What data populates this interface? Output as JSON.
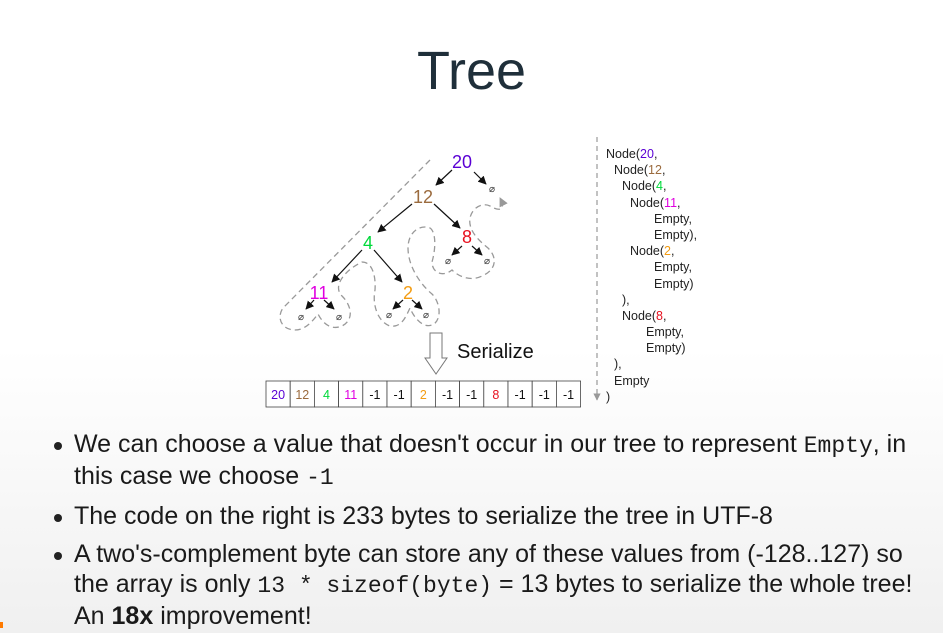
{
  "title": "Tree",
  "colors": {
    "purple": "#5a00d4",
    "brown": "#9b6b3e",
    "green": "#00d93a",
    "magenta": "#e000e0",
    "orange": "#f39c12",
    "red": "#e8101e",
    "gray_path": "#999999"
  },
  "tree": {
    "nodes": [
      {
        "label": "20",
        "color": "purple"
      },
      {
        "label": "12",
        "color": "brown"
      },
      {
        "label": "4",
        "color": "green"
      },
      {
        "label": "8",
        "color": "red"
      },
      {
        "label": "11",
        "color": "magenta"
      },
      {
        "label": "2",
        "color": "orange"
      }
    ],
    "empty_symbol": "⌀"
  },
  "serialize_label": "Serialize",
  "array": [
    {
      "value": "20",
      "color": "purple"
    },
    {
      "value": "12",
      "color": "brown"
    },
    {
      "value": "4",
      "color": "green"
    },
    {
      "value": "11",
      "color": "magenta"
    },
    {
      "value": "-1",
      "color": "black"
    },
    {
      "value": "-1",
      "color": "black"
    },
    {
      "value": "2",
      "color": "orange"
    },
    {
      "value": "-1",
      "color": "black"
    },
    {
      "value": "-1",
      "color": "black"
    },
    {
      "value": "8",
      "color": "red"
    },
    {
      "value": "-1",
      "color": "black"
    },
    {
      "value": "-1",
      "color": "black"
    },
    {
      "value": "-1",
      "color": "black"
    }
  ],
  "code_lines": [
    {
      "indent": 0,
      "pre": "Node(",
      "num": "20",
      "color": "purple",
      "post": ","
    },
    {
      "indent": 1,
      "pre": "Node(",
      "num": "12",
      "color": "brown",
      "post": ","
    },
    {
      "indent": 2,
      "pre": "Node(",
      "num": "4",
      "color": "green",
      "post": ","
    },
    {
      "indent": 3,
      "pre": "Node(",
      "num": "11",
      "color": "magenta",
      "post": ","
    },
    {
      "indent": 6,
      "pre": "Empty,",
      "num": "",
      "color": "",
      "post": ""
    },
    {
      "indent": 6,
      "pre": "Empty),",
      "num": "",
      "color": "",
      "post": ""
    },
    {
      "indent": 3,
      "pre": "Node(",
      "num": "2",
      "color": "orange",
      "post": ","
    },
    {
      "indent": 6,
      "pre": "Empty,",
      "num": "",
      "color": "",
      "post": ""
    },
    {
      "indent": 6,
      "pre": "Empty)",
      "num": "",
      "color": "",
      "post": ""
    },
    {
      "indent": 2,
      "pre": "),",
      "num": "",
      "color": "",
      "post": ""
    },
    {
      "indent": 2,
      "pre": "Node(",
      "num": "8",
      "color": "red",
      "post": ","
    },
    {
      "indent": 5,
      "pre": "Empty,",
      "num": "",
      "color": "",
      "post": ""
    },
    {
      "indent": 5,
      "pre": "Empty)",
      "num": "",
      "color": "",
      "post": ""
    },
    {
      "indent": 1,
      "pre": "),",
      "num": "",
      "color": "",
      "post": ""
    },
    {
      "indent": 1,
      "pre": "Empty",
      "num": "",
      "color": "",
      "post": ""
    },
    {
      "indent": 0,
      "pre": ")",
      "num": "",
      "color": "",
      "post": ""
    }
  ],
  "bullets": {
    "b1_text": "We can choose a value that doesn't occur in our tree to represent",
    "b1_code": "Empty",
    "b1_text2": ", in this case we choose ",
    "b1_code2": "-1",
    "b2_text": "The code on the right is 233 bytes to serialize the tree in UTF-8",
    "b3_text": "A two's-complement byte can store any of these values from (-128..127) so the array is only ",
    "b3_code": "13 * sizeof(byte)",
    "b3_text2": " = 13 bytes to serialize the whole tree! An ",
    "b3_bold": "18x",
    "b3_text3": " improvement!"
  }
}
